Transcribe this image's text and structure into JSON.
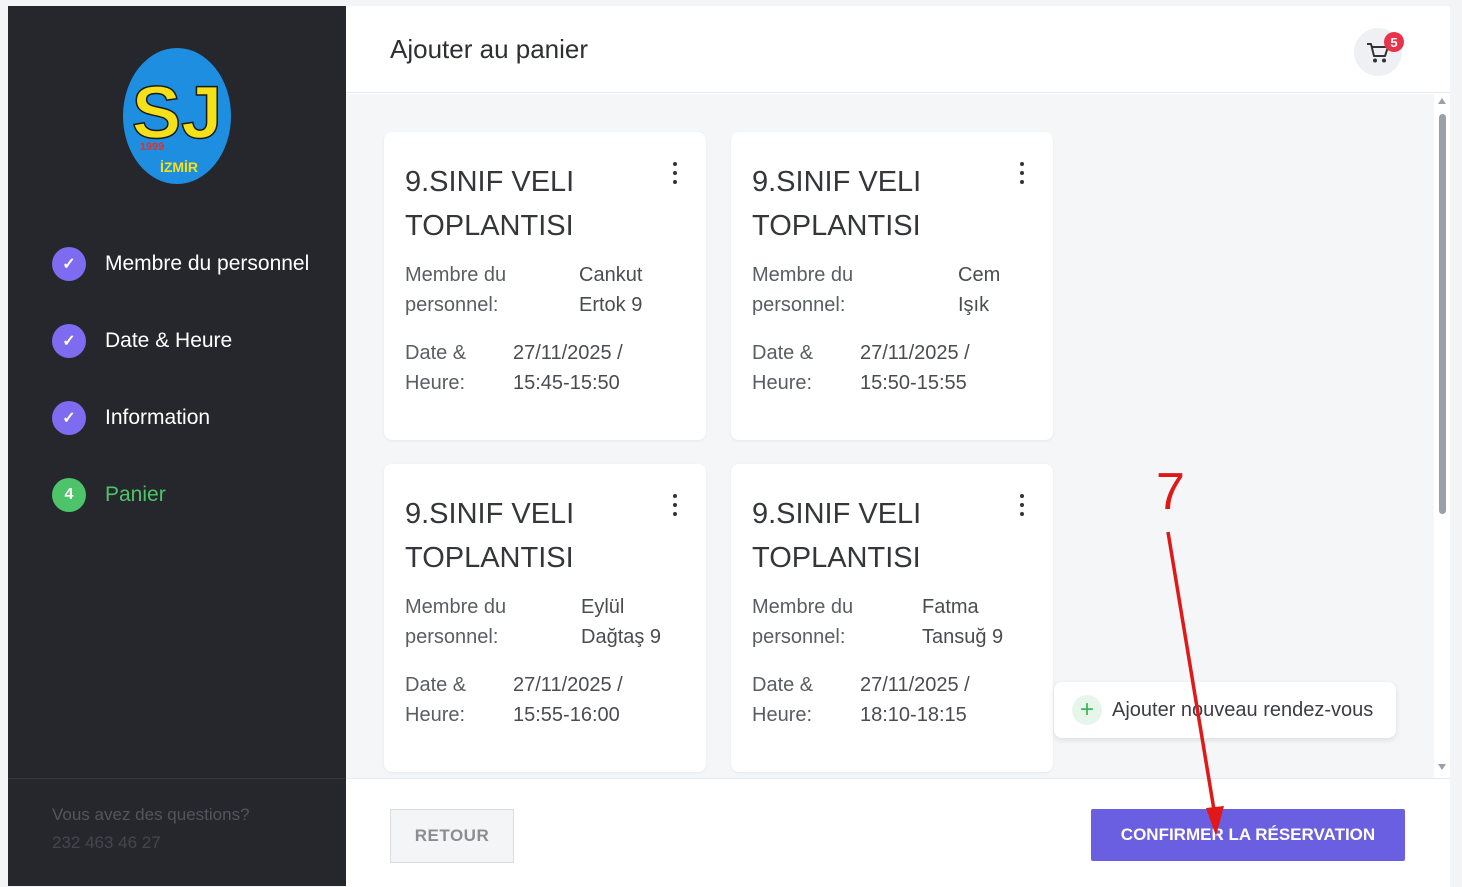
{
  "sidebar": {
    "logo": {
      "letters": "SJ",
      "year": "1999",
      "city": "İZMİR"
    },
    "steps": [
      {
        "label": "Membre du personnel",
        "status": "done",
        "icon": "check-icon"
      },
      {
        "label": "Date & Heure",
        "status": "done",
        "icon": "check-icon"
      },
      {
        "label": "Information",
        "status": "done",
        "icon": "check-icon"
      },
      {
        "label": "Panier",
        "status": "current",
        "number": "4"
      }
    ],
    "questions_text": "Vous avez des questions?",
    "phone": "232 463 46 27"
  },
  "header": {
    "title": "Ajouter au panier",
    "cart_count": "5"
  },
  "cards": [
    {
      "title": "9.SINIF VELI TOPLANTISI",
      "staff_label": "Membre du personnel:",
      "staff_value": "Cankut Ertok 9",
      "date_label": "Date & Heure:",
      "date_value": "27/11/2025 / 15:45-15:50"
    },
    {
      "title": "9.SINIF VELI TOPLANTISI",
      "staff_label": "Membre du personnel:",
      "staff_value": "Cem Işık",
      "date_label": "Date & Heure:",
      "date_value": "27/11/2025 / 15:50-15:55"
    },
    {
      "title": "9.SINIF VELI TOPLANTISI",
      "staff_label": "Membre du personnel:",
      "staff_value": "Eylül Dağtaş 9",
      "date_label": "Date & Heure:",
      "date_value": "27/11/2025 / 15:55-16:00"
    },
    {
      "title": "9.SINIF VELI TOPLANTISI",
      "staff_label": "Membre du personnel:",
      "staff_value": "Fatma Tansuğ 9",
      "date_label": "Date & Heure:",
      "date_value": "27/11/2025 / 18:10-18:15"
    }
  ],
  "add_appointment_label": "Ajouter nouveau rendez-vous",
  "footer": {
    "back_label": "RETOUR",
    "confirm_label": "CONFIRMER LA RÉSERVATION"
  },
  "annotation": {
    "number": "7",
    "color": "#e01818"
  },
  "colors": {
    "accent": "#6a5fe0",
    "success": "#4dc46a",
    "sidebar": "#25272d",
    "badge": "#e8334a"
  }
}
